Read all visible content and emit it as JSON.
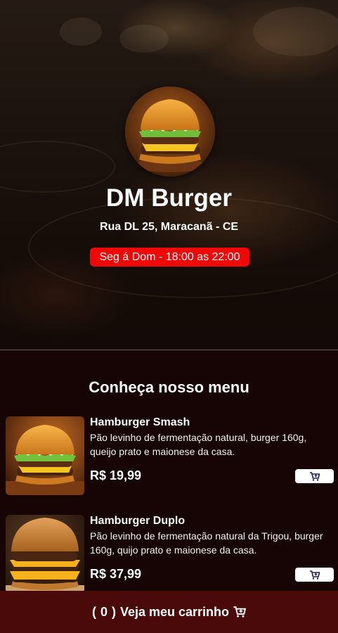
{
  "header": {
    "restaurant_name": "DM Burger",
    "address": "Rua DL 25, Maracanã - CE",
    "hours": "Seg á Dom - 18:00 as 22:00",
    "hours_badge_color": "#f00808"
  },
  "menu": {
    "title": "Conheça nosso menu",
    "items": [
      {
        "name": "Hamburger Smash",
        "description": "Pão levinho de fermentação natural, burger 160g, queijo prato e maionese da casa.",
        "price": "R$ 19,99",
        "add_icon": "cart-plus-icon"
      },
      {
        "name": "Hamburger Duplo",
        "description": "Pão levinho de fermentação natural da Trigou, burger 160g, quijo prato e maionese da casa.",
        "price": "R$ 37,99",
        "add_icon": "cart-plus-icon"
      }
    ]
  },
  "cart_bar": {
    "open_paren": "(",
    "count": "0",
    "close_paren": ")",
    "label": "Veja meu carrinho",
    "icon": "cart-icon",
    "background": "#4a0a0a"
  }
}
